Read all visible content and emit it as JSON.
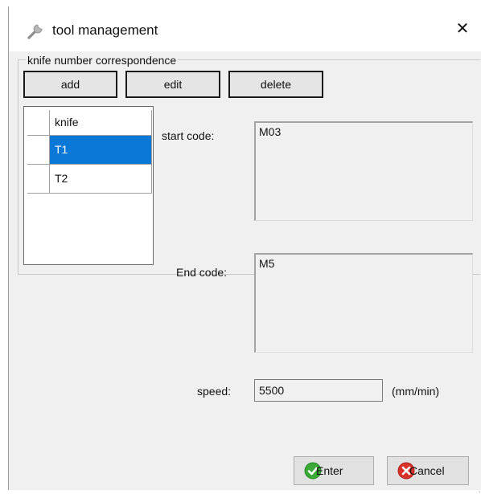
{
  "window": {
    "title": "tool management",
    "close_glyph": "✕",
    "icon": "wrench-icon"
  },
  "group": {
    "legend": "knife number correspondence",
    "buttons": {
      "add": "add",
      "edit": "edit",
      "delete": "delete"
    }
  },
  "tools_table": {
    "header": "knife",
    "rows": [
      {
        "label": "T1",
        "selected": true
      },
      {
        "label": "T2",
        "selected": false
      }
    ]
  },
  "details": {
    "start_code_label": "start code:",
    "start_code_value": "M03",
    "end_code_label": "End code:",
    "end_code_value": "M5",
    "speed_label": "speed:",
    "speed_value": "5500",
    "speed_unit": "(mm/min)"
  },
  "footer": {
    "enter_label": "Enter",
    "cancel_label": "Cancel"
  },
  "colors": {
    "selection": "#0a78d7",
    "dialog_bg": "#f0f0f0",
    "ok_green": "#3aa935",
    "cancel_red": "#d9302a"
  }
}
